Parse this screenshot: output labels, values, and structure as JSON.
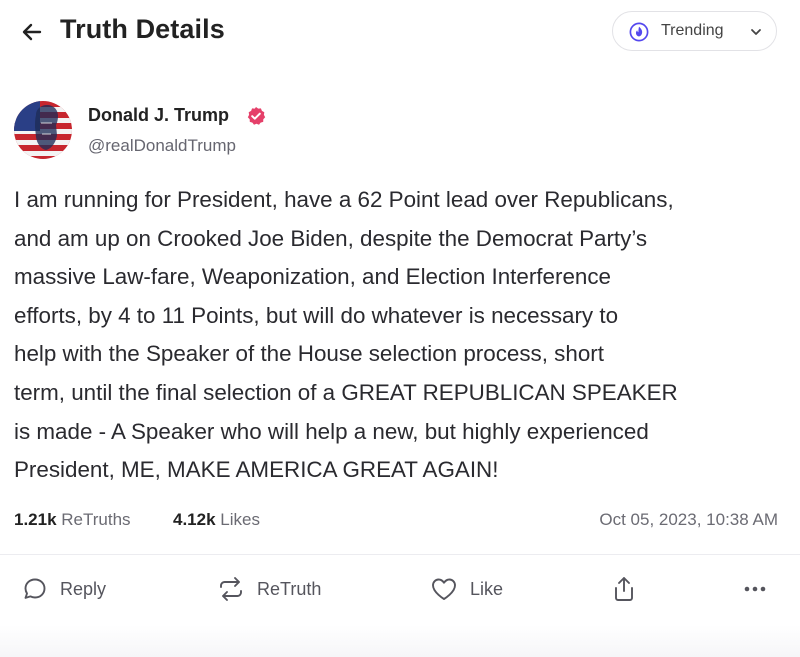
{
  "header": {
    "title": "Truth Details",
    "trending_label": "Trending"
  },
  "author": {
    "name": "Donald J. Trump",
    "handle": "@realDonaldTrump"
  },
  "post": {
    "lines": [
      "I am running for President, have a 62 Point lead over Republicans,",
      "and am up on Crooked Joe Biden, despite the Democrat Party’s",
      "massive Law-fare, Weaponization, and Election Interference",
      "efforts, by 4 to 11 Points, but will do whatever is necessary to",
      "help with the Speaker of the House selection process, short",
      "term, until the final selection of a GREAT REPUBLICAN SPEAKER",
      "is made - A Speaker who will help a new, but highly experienced",
      "President, ME, MAKE AMERICA GREAT AGAIN!"
    ],
    "retruths_count": "1.21k",
    "retruths_label": "ReTruths",
    "likes_count": "4.12k",
    "likes_label": "Likes",
    "timestamp": "Oct 05, 2023, 10:38 AM"
  },
  "actions": {
    "reply": "Reply",
    "retruth": "ReTruth",
    "like": "Like"
  },
  "colors": {
    "verified_badge": "#e5406a",
    "accent": "#5448ee",
    "muted_text": "#6b6b73"
  },
  "icons": [
    "back-arrow-icon",
    "trending-icon",
    "chevron-down-icon",
    "verified-badge-icon",
    "reply-icon",
    "retruth-icon",
    "like-icon",
    "share-icon",
    "more-icon"
  ]
}
